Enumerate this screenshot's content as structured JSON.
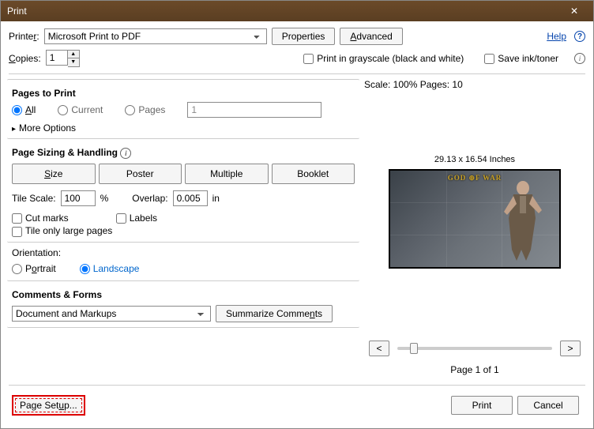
{
  "title": "Print",
  "close_glyph": "✕",
  "top": {
    "printer_label": "Printer:",
    "printer_value": "Microsoft Print to PDF",
    "properties": "Properties",
    "advanced": "Advanced",
    "help": "Help",
    "copies_label": "Copies:",
    "copies_value": "1",
    "grayscale": "Print in grayscale (black and white)",
    "saveink": "Save ink/toner"
  },
  "pages": {
    "title": "Pages to Print",
    "all": "All",
    "current": "Current",
    "pages": "Pages",
    "pages_value": "1",
    "more": "More Options"
  },
  "sizing": {
    "title": "Page Sizing & Handling",
    "size": "Size",
    "poster": "Poster",
    "multiple": "Multiple",
    "booklet": "Booklet",
    "tile_scale_label": "Tile Scale:",
    "tile_scale_value": "100",
    "pct": "%",
    "overlap_label": "Overlap:",
    "overlap_value": "0.005",
    "in": "in",
    "cutmarks": "Cut marks",
    "labels": "Labels",
    "tilelarge": "Tile only large pages"
  },
  "orientation": {
    "title": "Orientation:",
    "portrait": "Portrait",
    "landscape": "Landscape"
  },
  "comments": {
    "title": "Comments & Forms",
    "value": "Document and Markups",
    "summarize": "Summarize Comments"
  },
  "preview": {
    "scale_text": "Scale: 100% Pages: 10",
    "dimensions": "29.13 x 16.54 Inches",
    "logo": "GOD ⊕F WAR",
    "pageof": "Page 1 of 1",
    "prev": "<",
    "next": ">"
  },
  "footer": {
    "pagesetup": "Page Setup...",
    "print": "Print",
    "cancel": "Cancel"
  }
}
